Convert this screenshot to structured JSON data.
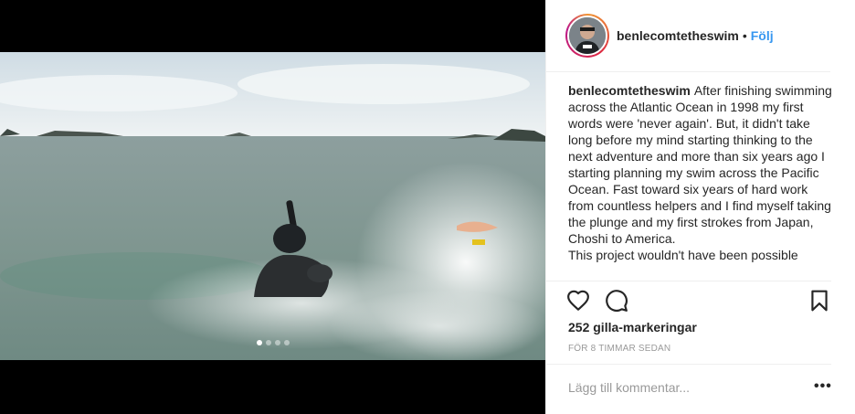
{
  "post": {
    "username": "benlecomtetheswim",
    "separator": "•",
    "follow_label": "Följ",
    "caption_user": "benlecomtetheswim",
    "caption_text": "After finishing swimming across the Atlantic Ocean in 1998 my first words were 'never again'. But, it didn't take long before my mind starting thinking to the next adventure and more than six years ago I starting planning my swim across the Pacific Ocean. Fast toward six years of hard work from countless helpers and I find myself taking the plunge and my first strokes from Japan, Choshi to America.",
    "caption_text_2": "This project wouldn't have been possible",
    "likes": "252 gilla-markeringar",
    "time": "FÖR 8 TIMMAR SEDAN",
    "comment_placeholder": "Lägg till kommentar...",
    "more_label": "•••"
  },
  "media": {
    "slide_count": 4,
    "active_slide": 1
  },
  "icons": {
    "like": "heart-icon",
    "comment": "comment-bubble-icon",
    "save": "bookmark-icon",
    "more": "more-options-icon"
  },
  "colors": {
    "follow": "#3897f0",
    "text": "#262626",
    "muted": "#999999",
    "border": "#efefef"
  }
}
